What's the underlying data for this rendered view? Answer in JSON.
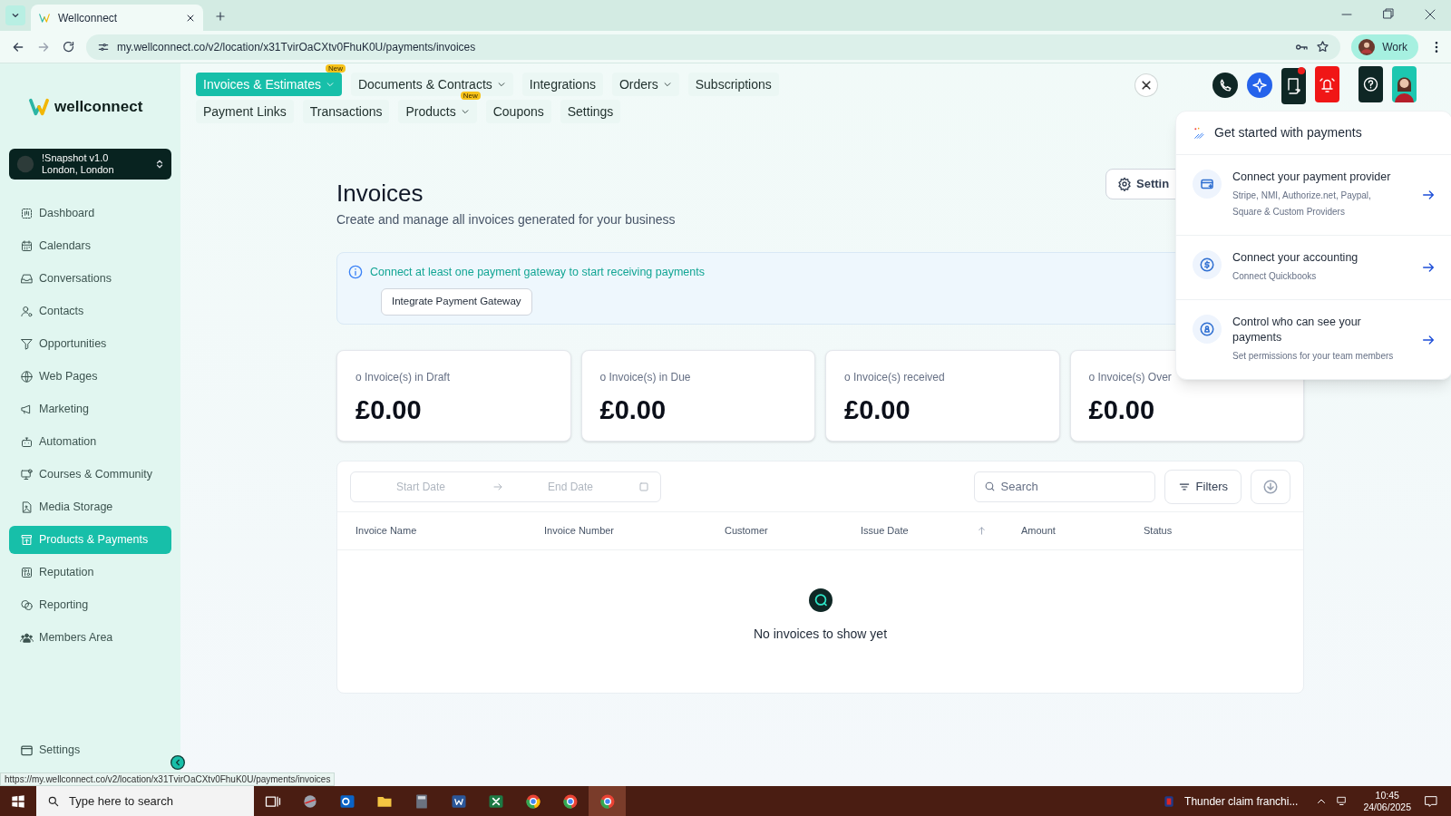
{
  "browser": {
    "tab_title": "Wellconnect",
    "url": "my.wellconnect.co/v2/location/x31TvirOaCXtv0FhuK0U/payments/invoices",
    "profile_label": "Work"
  },
  "app": {
    "logo": "wellconnect",
    "location": {
      "name": "!Snapshot v1.0",
      "address": "London, London"
    },
    "sidebar": {
      "items": [
        {
          "label": "Dashboard",
          "selected": false
        },
        {
          "label": "Calendars",
          "selected": false
        },
        {
          "label": "Conversations",
          "selected": false
        },
        {
          "label": "Contacts",
          "selected": false
        },
        {
          "label": "Opportunities",
          "selected": false
        },
        {
          "label": "Web Pages",
          "selected": false
        },
        {
          "label": "Marketing",
          "selected": false
        },
        {
          "label": "Automation",
          "selected": false
        },
        {
          "label": "Courses & Community",
          "selected": false
        },
        {
          "label": "Media Storage",
          "selected": false
        },
        {
          "label": "Products & Payments",
          "selected": true
        },
        {
          "label": "Reputation",
          "selected": false
        },
        {
          "label": "Reporting",
          "selected": false
        },
        {
          "label": "Members Area",
          "selected": false
        }
      ],
      "footer_item": "Settings"
    },
    "top_nav": [
      [
        {
          "label": "Invoices & Estimates",
          "selected": true,
          "dropdown": true,
          "badge": "New"
        },
        {
          "label": "Documents & Contracts",
          "selected": false,
          "dropdown": true
        },
        {
          "label": "Integrations",
          "selected": false,
          "dropdown": false
        },
        {
          "label": "Orders",
          "selected": false,
          "dropdown": true
        },
        {
          "label": "Subscriptions",
          "selected": false,
          "dropdown": false
        }
      ],
      [
        {
          "label": "Payment Links",
          "selected": false,
          "dropdown": false
        },
        {
          "label": "Transactions",
          "selected": false,
          "dropdown": false
        },
        {
          "label": "Products",
          "selected": false,
          "dropdown": true,
          "badge": "New"
        },
        {
          "label": "Coupons",
          "selected": false,
          "dropdown": false
        },
        {
          "label": "Settings",
          "selected": false,
          "dropdown": false
        }
      ]
    ]
  },
  "page": {
    "title": "Invoices",
    "subtitle": "Create and manage all invoices generated for your business",
    "settings_button": "Settin",
    "alert": {
      "text": "Connect at least one payment gateway to start receiving payments",
      "button": "Integrate Payment Gateway"
    },
    "stats": [
      {
        "label": "o Invoice(s) in Draft",
        "amount": "£0.00"
      },
      {
        "label": "o Invoice(s) in Due",
        "amount": "£0.00"
      },
      {
        "label": "o Invoice(s) received",
        "amount": "£0.00"
      },
      {
        "label": "o Invoice(s) Over",
        "amount": "£0.00"
      }
    ],
    "table": {
      "start_date_placeholder": "Start Date",
      "end_date_placeholder": "End Date",
      "search_placeholder": "Search",
      "filters_button": "Filters",
      "columns": [
        "Invoice Name",
        "Invoice Number",
        "Customer",
        "Issue Date",
        "Amount",
        "Status"
      ],
      "empty_text": "No invoices to show yet"
    }
  },
  "popup": {
    "title": "Get started with payments",
    "items": [
      {
        "title": "Connect your payment provider",
        "description": "Stripe, NMI, Authorize.net, Paypal, Square & Custom Providers"
      },
      {
        "title": "Connect your accounting",
        "description": "Connect Quickbooks"
      },
      {
        "title": "Control who can see your payments",
        "description": "Set permissions for your team members"
      }
    ]
  },
  "status_url": "https://my.wellconnect.co/v2/location/x31TvirOaCXtv0FhuK0U/payments/invoices",
  "taskbar": {
    "search_placeholder": "Type here to search",
    "news": "Thunder claim franchi...",
    "time": "10:45",
    "date": "24/06/2025"
  }
}
